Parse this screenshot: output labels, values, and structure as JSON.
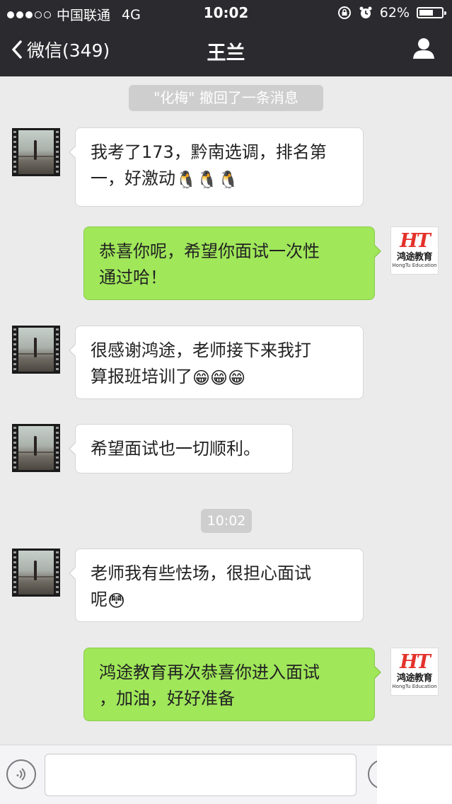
{
  "status_bar": {
    "carrier": "中国联通",
    "network": "4G",
    "time": "10:02",
    "battery_percent": "62%",
    "battery_level": 0.62,
    "signal_filled_dots": 3,
    "signal_total_dots": 5
  },
  "nav": {
    "back_label": "微信(349)",
    "title": "王兰"
  },
  "chat": {
    "recall_notice": "\"化梅\" 撤回了一条消息",
    "time_divider": "10:02",
    "messages": [
      {
        "side": "left",
        "lines": [
          "我考了173，黔南选调，排名第",
          "一，好激动"
        ],
        "emoji": [
          "🐧",
          "🐧",
          "🐧"
        ]
      },
      {
        "side": "right",
        "lines": [
          "恭喜你呢，希望你面试一次性",
          "通过哈！"
        ],
        "emoji": []
      },
      {
        "side": "left",
        "lines": [
          "很感谢鸿途，老师接下来我打",
          "算报班培训了"
        ],
        "emoji": [
          "😁",
          "😁",
          "😁"
        ]
      },
      {
        "side": "left",
        "lines": [
          "希望面试也一切顺利。"
        ],
        "emoji": []
      },
      {
        "side": "left",
        "lines": [
          "老师我有些怯场，很担心面试",
          "呢"
        ],
        "emoji": [
          "😳"
        ]
      },
      {
        "side": "right",
        "lines": [
          "鸿途教育再次恭喜你进入面试",
          "，加油，好好准备"
        ],
        "emoji": []
      }
    ]
  },
  "brand_avatar": {
    "logo_text": "HT",
    "name_cn": "鸿途教育",
    "name_en": "HongTu Education",
    "logo_color": "#e3322b"
  },
  "colors": {
    "bar_bg": "#2b2b2f",
    "chat_bg": "#ebebeb",
    "bubble_sent": "#a0e75a",
    "bubble_received": "#ffffff"
  },
  "input": {
    "placeholder": ""
  }
}
